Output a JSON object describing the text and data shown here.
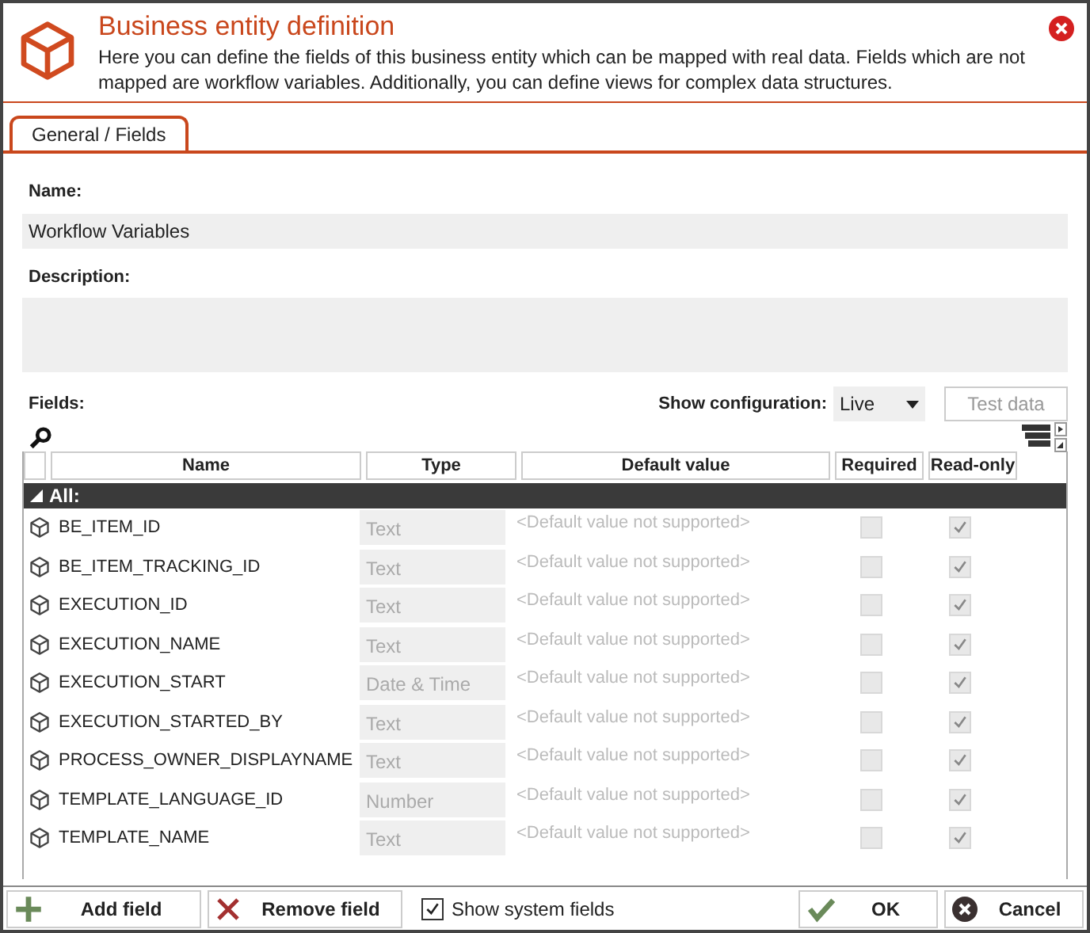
{
  "header": {
    "title": "Business entity definition",
    "description": "Here you can define the fields of this business entity which can be mapped with real data. Fields which are not mapped are workflow variables. Additionally, you can define views for complex data structures."
  },
  "tabs": [
    {
      "label": "General / Fields",
      "selected": true
    }
  ],
  "name": {
    "label": "Name:",
    "value": "Workflow Variables"
  },
  "description": {
    "label": "Description:"
  },
  "fields": {
    "label": "Fields:",
    "config_label": "Show configuration:",
    "config_value": "Live",
    "test_button": "Test data"
  },
  "table": {
    "columns": [
      "Name",
      "Type",
      "Default value",
      "Required",
      "Read-only"
    ],
    "group": {
      "label": "All:",
      "expanded": true
    },
    "rows": [
      {
        "name": "BE_ITEM_ID",
        "type": "Text",
        "default": "<Default value not supported>",
        "required": false,
        "read_only": true
      },
      {
        "name": "BE_ITEM_TRACKING_ID",
        "type": "Text",
        "default": "<Default value not supported>",
        "required": false,
        "read_only": true
      },
      {
        "name": "EXECUTION_ID",
        "type": "Text",
        "default": "<Default value not supported>",
        "required": false,
        "read_only": true
      },
      {
        "name": "EXECUTION_NAME",
        "type": "Text",
        "default": "<Default value not supported>",
        "required": false,
        "read_only": true
      },
      {
        "name": "EXECUTION_START",
        "type": "Date & Time",
        "default": "<Default value not supported>",
        "required": false,
        "read_only": true
      },
      {
        "name": "EXECUTION_STARTED_BY",
        "type": "Text",
        "default": "<Default value not supported>",
        "required": false,
        "read_only": true
      },
      {
        "name": "PROCESS_OWNER_DISPLAYNAME",
        "type": "Text",
        "default": "<Default value not supported>",
        "required": false,
        "read_only": true
      },
      {
        "name": "TEMPLATE_LANGUAGE_ID",
        "type": "Number",
        "default": "<Default value not supported>",
        "required": false,
        "read_only": true
      },
      {
        "name": "TEMPLATE_NAME",
        "type": "Text",
        "default": "<Default value not supported>",
        "required": false,
        "read_only": true
      }
    ]
  },
  "footer": {
    "add": "Add field",
    "remove": "Remove field",
    "show_system": {
      "label": "Show system fields",
      "checked": true
    },
    "ok": "OK",
    "cancel": "Cancel"
  }
}
